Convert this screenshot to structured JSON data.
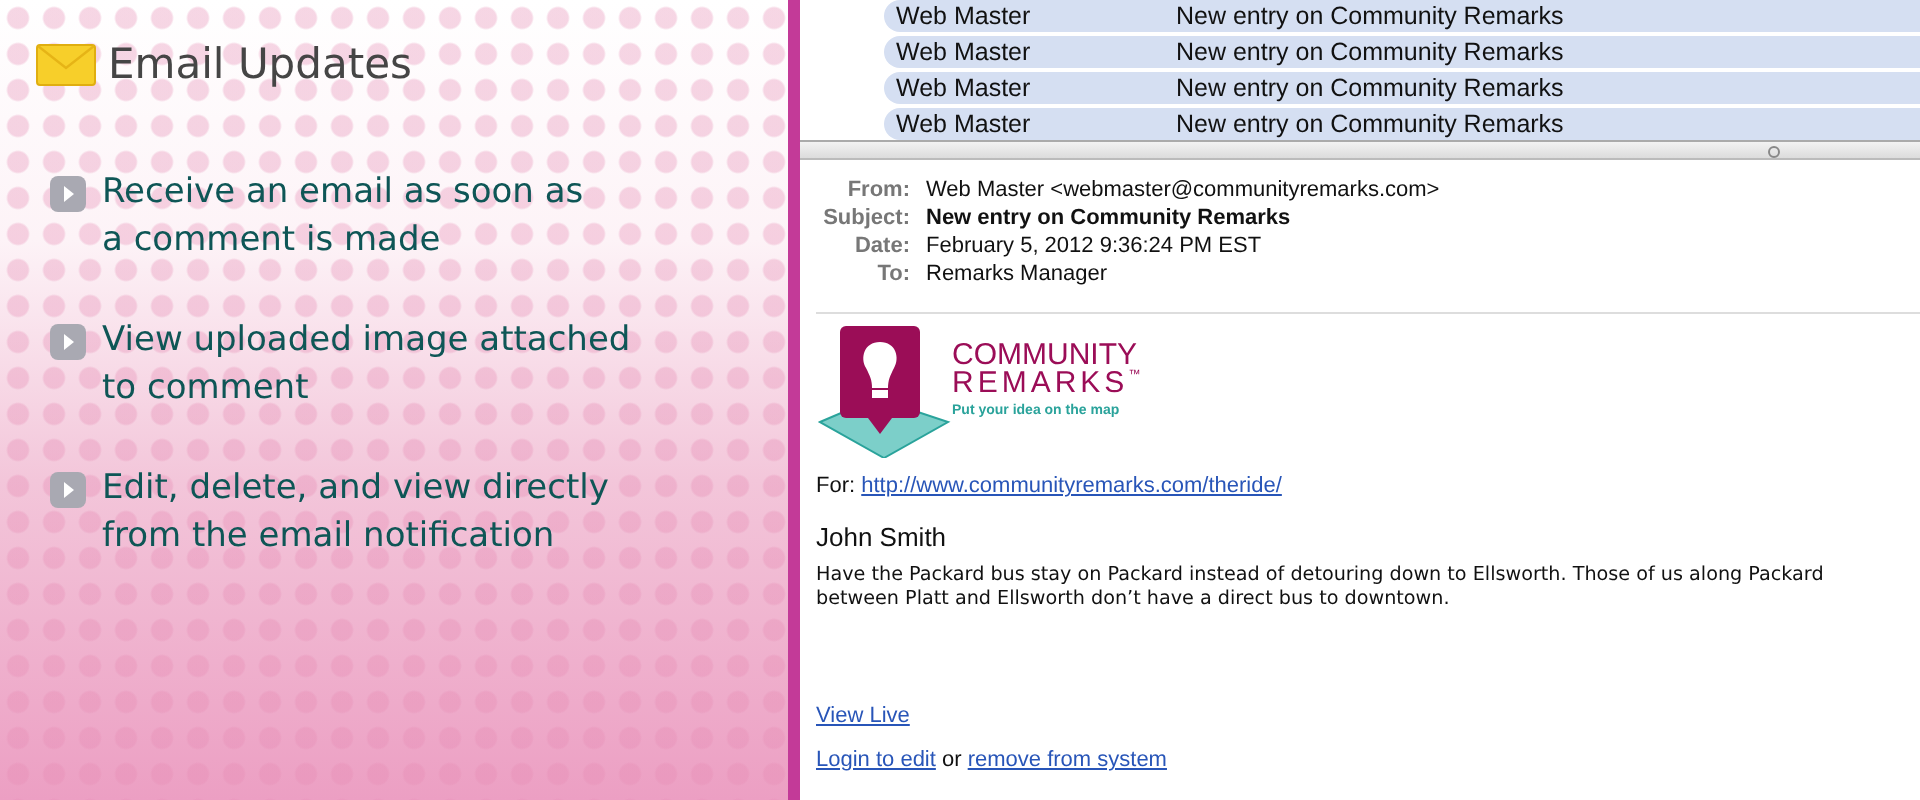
{
  "heading": "Email Updates",
  "features": [
    {
      "lines": [
        "Receive an email as soon as",
        "a comment is made"
      ]
    },
    {
      "lines": [
        "View uploaded image attached",
        "to comment"
      ]
    },
    {
      "lines": [
        "Edit, delete, and view directly",
        "from the email notification"
      ]
    }
  ],
  "message_list": [
    {
      "from": "Web Master",
      "subject": "New entry on Community Remarks",
      "selected": true
    },
    {
      "from": "Web Master",
      "subject": "New entry on Community Remarks",
      "selected": true
    },
    {
      "from": "Web Master",
      "subject": "New entry on Community Remarks",
      "selected": true
    },
    {
      "from": "Web Master",
      "subject": "New entry on Community Remarks",
      "selected": true
    }
  ],
  "headers": [
    {
      "label": "From:",
      "value": "Web Master <webmaster@communityremarks.com>",
      "kind": "plain"
    },
    {
      "label": "Subject:",
      "value": "New entry on Community Remarks",
      "kind": "bold"
    },
    {
      "label": "Date:",
      "value": "February 5, 2012 9:36:24 PM EST",
      "kind": "plain"
    },
    {
      "label": "To:",
      "value": "Remarks Manager",
      "kind": "plain"
    }
  ],
  "logo": {
    "line_1": "COMMUNITY",
    "line_2": "REMARKS",
    "trademark": "™",
    "tagline": "Put your idea on the map"
  },
  "for": {
    "label": "For:",
    "link": "http://www.communityremarks.com/theride/"
  },
  "author": "John Smith",
  "comment": "Have the Packard bus stay on Packard instead of detouring down to Ellsworth. Those of us along Packard between Platt and Ellsworth don’t have a direct bus to downtown.",
  "view_live": "View Live",
  "actions": {
    "login": "Login to edit",
    "separator": "or",
    "remove": "remove from system"
  }
}
